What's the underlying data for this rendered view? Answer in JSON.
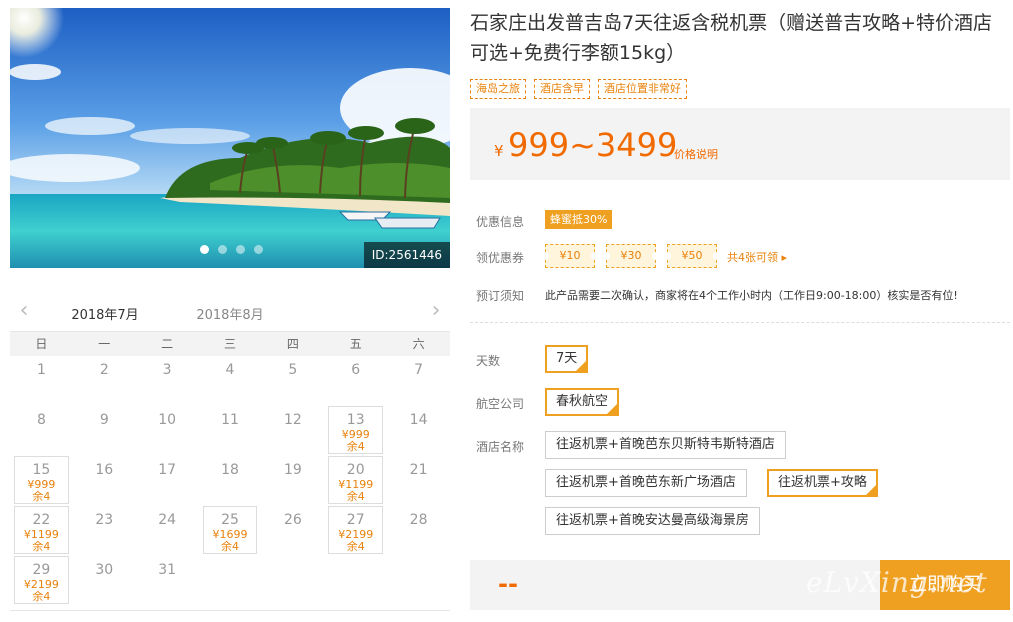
{
  "hero": {
    "image_id": "ID:2561446",
    "dot_count": 4,
    "active_dot": 0
  },
  "calendar": {
    "months": [
      "2018年7月",
      "2018年8月"
    ],
    "weekdays": [
      "日",
      "一",
      "二",
      "三",
      "四",
      "五",
      "六"
    ],
    "days": [
      {
        "d": "1"
      },
      {
        "d": "2"
      },
      {
        "d": "3"
      },
      {
        "d": "4"
      },
      {
        "d": "5"
      },
      {
        "d": "6"
      },
      {
        "d": "7"
      },
      {
        "d": "8"
      },
      {
        "d": "9"
      },
      {
        "d": "10"
      },
      {
        "d": "11"
      },
      {
        "d": "12"
      },
      {
        "d": "13",
        "price": "¥999",
        "remain": "余4"
      },
      {
        "d": "14"
      },
      {
        "d": "15",
        "price": "¥999",
        "remain": "余4"
      },
      {
        "d": "16"
      },
      {
        "d": "17"
      },
      {
        "d": "18"
      },
      {
        "d": "19"
      },
      {
        "d": "20",
        "price": "¥1199",
        "remain": "余4"
      },
      {
        "d": "21"
      },
      {
        "d": "22",
        "price": "¥1199",
        "remain": "余4"
      },
      {
        "d": "23"
      },
      {
        "d": "24"
      },
      {
        "d": "25",
        "price": "¥1699",
        "remain": "余4"
      },
      {
        "d": "26"
      },
      {
        "d": "27",
        "price": "¥2199",
        "remain": "余4"
      },
      {
        "d": "28"
      },
      {
        "d": "29",
        "price": "¥2199",
        "remain": "余4"
      },
      {
        "d": "30"
      },
      {
        "d": "31"
      }
    ]
  },
  "product": {
    "title": "石家庄出发普吉岛7天往返含税机票（赠送普吉攻略+特价酒店可选+免费行李额15kg）",
    "tags": [
      "海岛之旅",
      "酒店含早",
      "酒店位置非常好"
    ],
    "price_currency": "¥",
    "price_range": "999~3499",
    "price_note": "价格说明"
  },
  "offers": {
    "promo_label": "优惠信息",
    "promo_badge": "蜂蜜抵30%",
    "coupon_label": "领优惠券",
    "coupons": [
      "¥10",
      "¥30",
      "¥50"
    ],
    "coupon_more": "共4张可领 ▸",
    "notice_label": "预订须知",
    "notice_text": "此产品需要二次确认，商家将在4个工作小时内（工作日9:00-18:00）核实是否有位!"
  },
  "options": {
    "days_label": "天数",
    "days": [
      "7天"
    ],
    "airline_label": "航空公司",
    "airlines": [
      "春秋航空"
    ],
    "hotel_label": "酒店名称",
    "hotels": [
      "往返机票+首晚芭东贝斯特韦斯特酒店",
      "往返机票+首晚芭东新广场酒店",
      "往返机票+攻略",
      "往返机票+首晚安达曼高级海景房"
    ],
    "selected_hotel": 2
  },
  "buy": {
    "price_placeholder": "--",
    "button_label": "立即购买",
    "watermark": "eLvXing.net"
  },
  "colors": {
    "accent": "#f0a020",
    "price": "#f06a00"
  }
}
